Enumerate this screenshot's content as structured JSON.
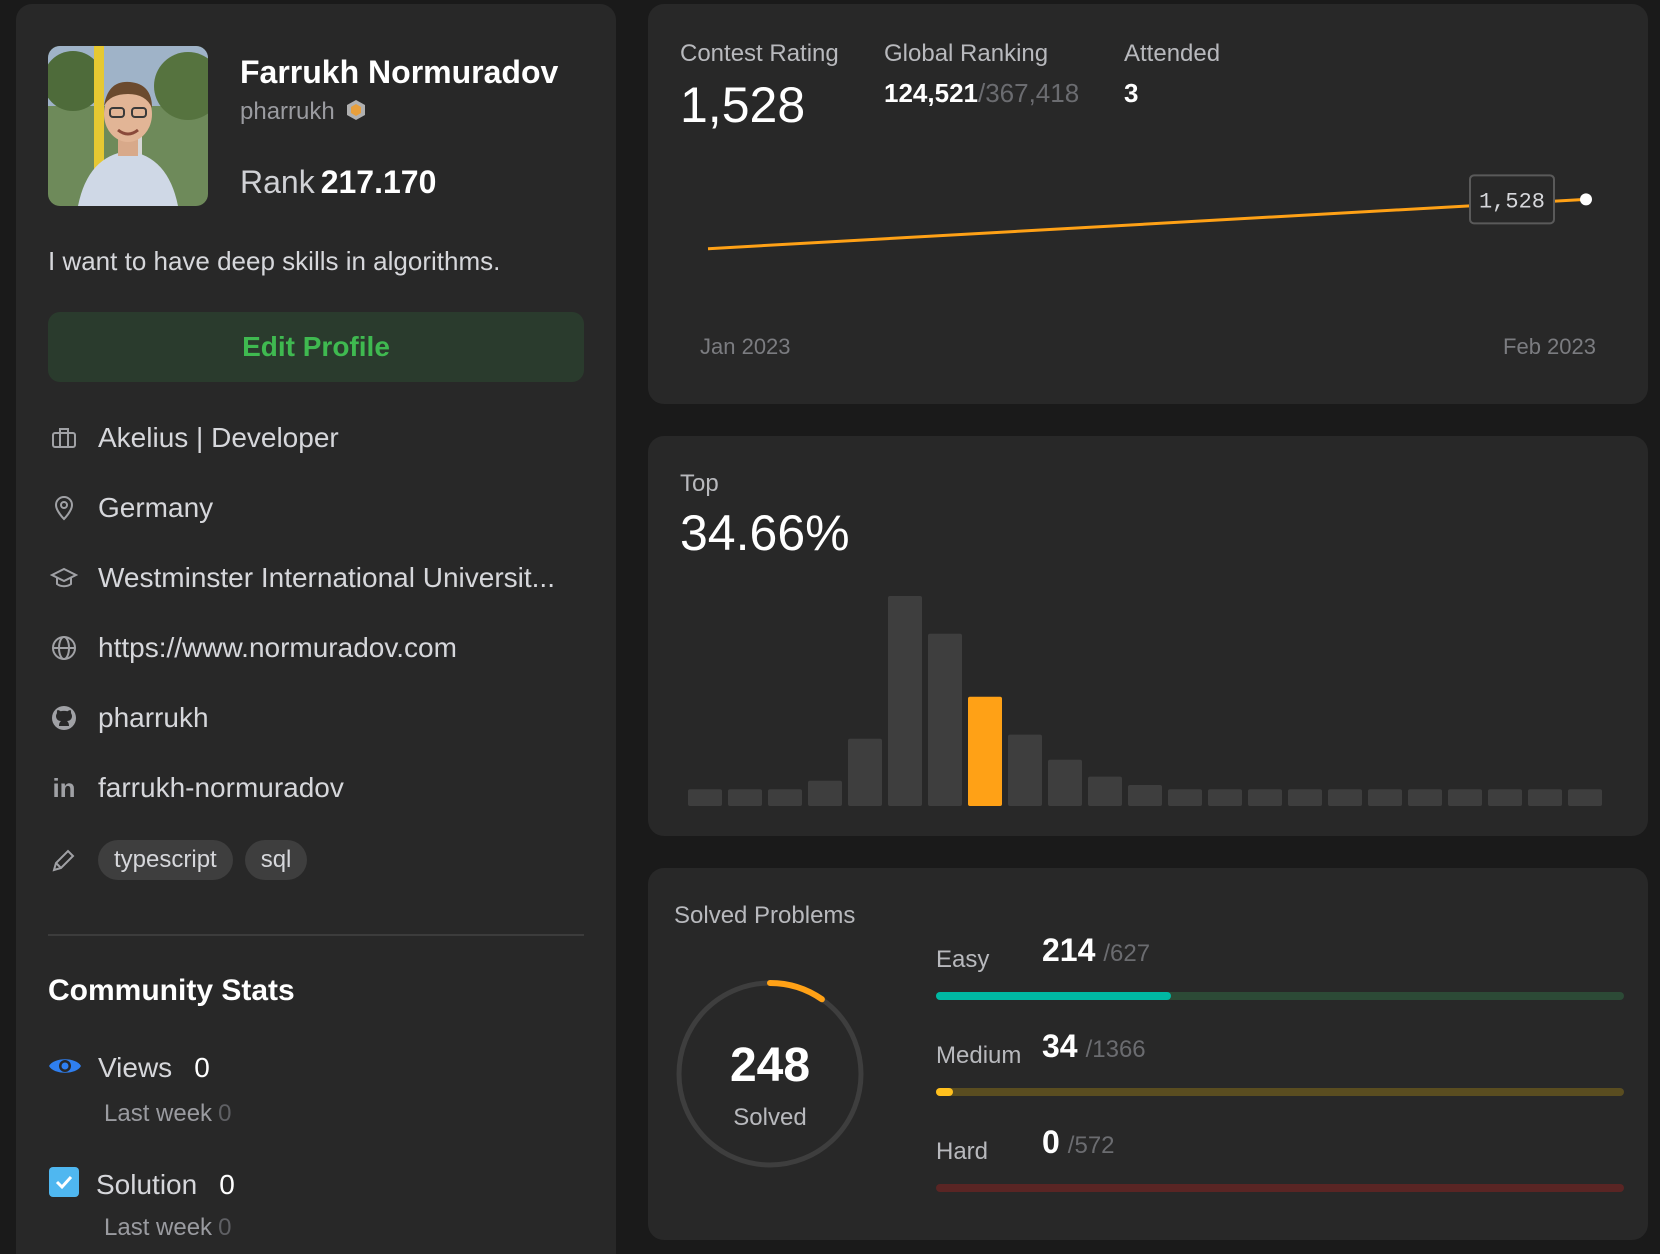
{
  "profile": {
    "name": "Farrukh Normuradov",
    "username": "pharrukh",
    "rank_label": "Rank",
    "rank_value": "217.170",
    "bio": "I want to have deep skills in algorithms.",
    "edit_button": "Edit Profile",
    "company": "Akelius | Developer",
    "location": "Germany",
    "school": "Westminster International Universit...",
    "website": "https://www.normuradov.com",
    "github": "pharrukh",
    "linkedin": "farrukh-normuradov",
    "skills": [
      "typescript",
      "sql"
    ]
  },
  "community": {
    "title": "Community Stats",
    "views_label": "Views",
    "views_value": "0",
    "views_sub_label": "Last week",
    "views_sub_value": "0",
    "solution_label": "Solution",
    "solution_value": "0",
    "solution_sub_label": "Last week",
    "solution_sub_value": "0"
  },
  "contest": {
    "rating_label": "Contest Rating",
    "rating_value": "1,528",
    "global_label": "Global Ranking",
    "global_value": "124,521",
    "global_total": "/367,418",
    "attended_label": "Attended",
    "attended_value": "3",
    "tooltip": "1,528",
    "axis_start": "Jan 2023",
    "axis_end": "Feb 2023"
  },
  "top": {
    "label": "Top",
    "value": "34.66%"
  },
  "solved": {
    "title": "Solved Problems",
    "total": "248",
    "total_label": "Solved",
    "easy_label": "Easy",
    "easy_solved": "214",
    "easy_total": "/627",
    "medium_label": "Medium",
    "medium_solved": "34",
    "medium_total": "/1366",
    "hard_label": "Hard",
    "hard_solved": "0",
    "hard_total": "/572"
  },
  "progress": {
    "easy_fraction": 0.341,
    "medium_fraction": 0.025,
    "hard_fraction": 0,
    "total_fraction": 0.0966
  },
  "colors": {
    "accent_orange": "#ffa116",
    "easy_fill": "#00b8a3",
    "easy_track": "#2c4a36",
    "medium_fill": "#ffc01e",
    "medium_track": "#5a4d20",
    "hard_fill": "#ef4743",
    "hard_track": "#5a2524",
    "edit_green": "#3fb950"
  },
  "chart_data": [
    {
      "type": "line",
      "x": [
        "Jan 2023",
        "Feb 2023"
      ],
      "series": [
        {
          "values": [
            1480,
            1528
          ]
        }
      ]
    },
    {
      "type": "bar",
      "values": [
        2,
        2,
        2,
        3,
        8,
        25,
        20.5,
        13,
        8.5,
        5.5,
        3.5,
        2.5,
        2,
        2,
        2,
        2,
        2,
        2,
        2,
        2,
        2,
        2,
        2
      ],
      "highlight_index": 7
    }
  ]
}
